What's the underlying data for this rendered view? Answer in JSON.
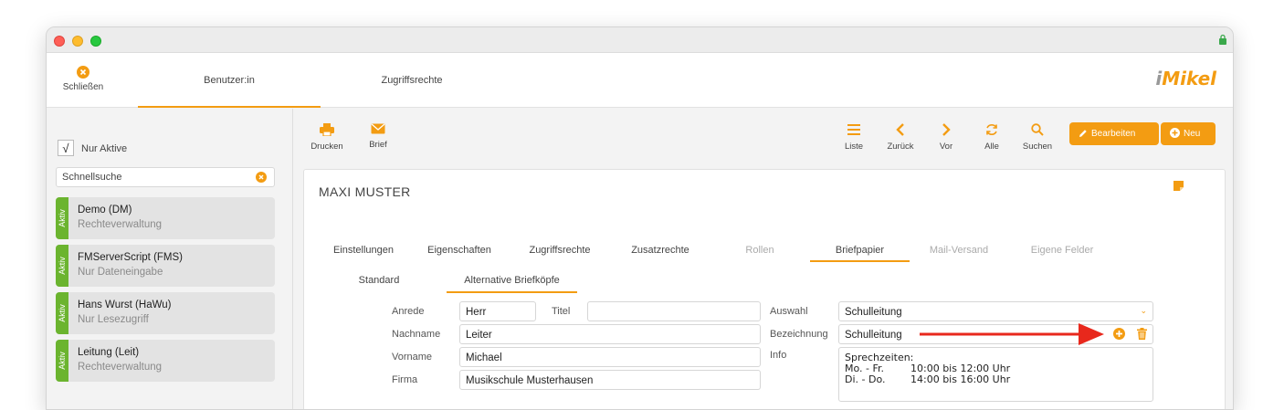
{
  "topnav": {
    "close_label": "Schließen",
    "tabs": [
      "Benutzer:in",
      "Zugriffsrechte"
    ],
    "logo_prefix": "i",
    "logo_text": "Mikel"
  },
  "sidebar": {
    "only_active_check": "√",
    "only_active_label": "Nur Aktive",
    "search_placeholder": "Schnellsuche",
    "users": [
      {
        "badge": "Aktiv",
        "name": "Demo (DM)",
        "role": "Rechteverwaltung"
      },
      {
        "badge": "Aktiv",
        "name": "FMServerScript (FMS)",
        "role": "Nur Dateneingabe"
      },
      {
        "badge": "Aktiv",
        "name": "Hans Wurst (HaWu)",
        "role": "Nur Lesezugriff"
      },
      {
        "badge": "Aktiv",
        "name": "Leitung (Leit)",
        "role": "Rechteverwaltung"
      }
    ]
  },
  "toolbar": {
    "print_label": "Drucken",
    "letter_label": "Brief",
    "list_label": "Liste",
    "back_label": "Zurück",
    "forward_label": "Vor",
    "all_label": "Alle",
    "search_label": "Suchen",
    "edit_label": "Bearbeiten",
    "new_label": "Neu"
  },
  "record": {
    "title": "MAXI MUSTER",
    "tabs": [
      "Einstellungen",
      "Eigenschaften",
      "Zugriffsrechte",
      "Zusatzrechte",
      "Rollen",
      "Briefpapier",
      "Mail-Versand",
      "Eigene Felder"
    ],
    "subtabs": [
      "Standard",
      "Alternative Briefköpfe"
    ],
    "form": {
      "anrede_label": "Anrede",
      "anrede_value": "Herr",
      "titel_label": "Titel",
      "titel_value": "",
      "nachname_label": "Nachname",
      "nachname_value": "Leiter",
      "vorname_label": "Vorname",
      "vorname_value": "Michael",
      "firma_label": "Firma",
      "firma_value": "Musikschule Musterhausen",
      "auswahl_label": "Auswahl",
      "auswahl_value": "Schulleitung",
      "bezeichnung_label": "Bezeichnung",
      "bezeichnung_value": "Schulleitung",
      "info_label": "Info",
      "info_lines": [
        {
          "k": "Sprechzeiten:",
          "v": ""
        },
        {
          "k": "Mo. - Fr.",
          "v": "10:00 bis 12:00 Uhr"
        },
        {
          "k": "Di. - Do.",
          "v": "14:00 bis 16:00 Uhr"
        }
      ]
    }
  },
  "colors": {
    "accent": "#f39c12",
    "active_badge": "#6bb42f",
    "annotation_arrow": "#e8281c"
  }
}
